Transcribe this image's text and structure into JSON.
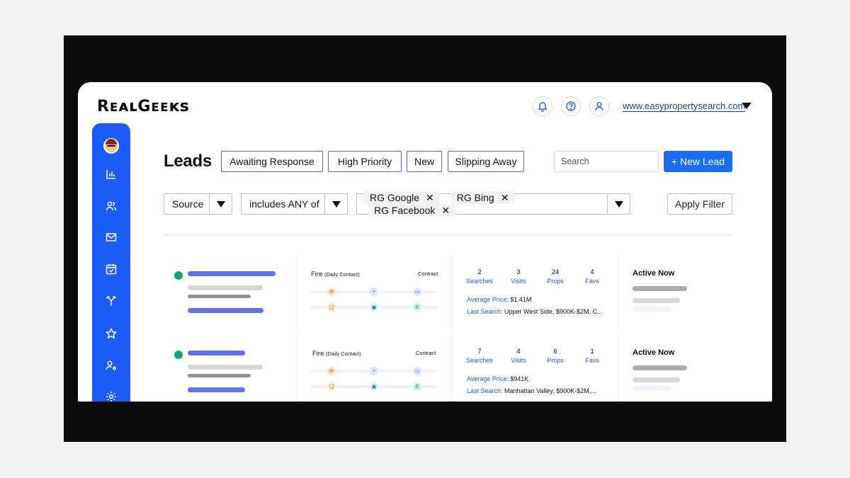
{
  "brand": {
    "logo_text": "RealGeeks"
  },
  "header": {
    "site_link": "www.easypropertysearch.com",
    "icons": [
      "bell-icon",
      "help-icon",
      "user-icon"
    ]
  },
  "sidebar": {
    "items": [
      "avatar",
      "chart-icon",
      "users-icon",
      "mail-icon",
      "calendar-icon",
      "routing-icon",
      "star-icon",
      "user-settings-icon",
      "gear-icon"
    ],
    "color": "#1a5cf5"
  },
  "page": {
    "title": "Leads",
    "tabs": [
      {
        "label": "Awaiting Response"
      },
      {
        "label": "High Priority"
      },
      {
        "label": "New"
      },
      {
        "label": "Slipping Away"
      }
    ],
    "search_placeholder": "Search",
    "new_lead_label": "+ New Lead"
  },
  "filters": {
    "field": "Source",
    "operator": "includes ANY of",
    "values": [
      "RG Google",
      "RG Bing",
      "RG Facebook"
    ],
    "remove_glyph": "✕",
    "apply_label": "Apply Filter"
  },
  "leads": [
    {
      "status_color": "#19a36b",
      "plan": "Fire",
      "plan_detail": "(Daily Contact)",
      "stage": "Contract",
      "stats": [
        {
          "value": "2",
          "label": "Searches"
        },
        {
          "value": "3",
          "label": "Visits"
        },
        {
          "value": "24",
          "label": "Props"
        },
        {
          "value": "4",
          "label": "Favs"
        }
      ],
      "avg_price_label": "Average Price:",
      "avg_price": "$1.41M",
      "last_search_label": "Last Search:",
      "last_search": "Upper West Side, $900K-$2M, C...",
      "activity": "Active Now"
    },
    {
      "status_color": "#19a36b",
      "plan": "Fire",
      "plan_detail": "(Daily Contact)",
      "stage": "Contract",
      "stats": [
        {
          "value": "7",
          "label": "Searches"
        },
        {
          "value": "4",
          "label": "Visits"
        },
        {
          "value": "6",
          "label": "Props"
        },
        {
          "value": "1",
          "label": "Favs"
        }
      ],
      "avg_price_label": "Average Price:",
      "avg_price": "$941K",
      "last_search_label": "Last Search:",
      "last_search": "Manhattan Valley, $900K-$2M,...",
      "activity": "Active Now"
    }
  ],
  "colors": {
    "accent": "#1a6df0",
    "tab_border": "#7a52d9",
    "link": "#2f57c7"
  }
}
